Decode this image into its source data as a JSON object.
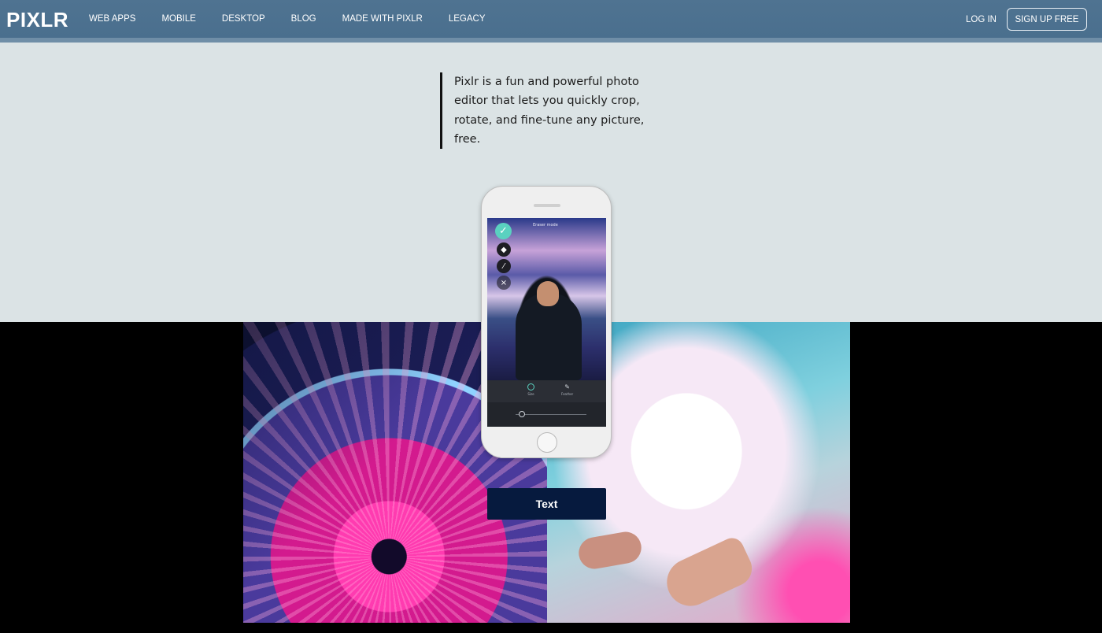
{
  "brand": {
    "logo": "PIXLR"
  },
  "nav": {
    "links": [
      "WEB APPS",
      "MOBILE",
      "DESKTOP",
      "BLOG",
      "MADE WITH PIXLR",
      "LEGACY"
    ],
    "login": "LOG IN",
    "signup": "SIGN UP FREE"
  },
  "hero": {
    "quote": "Pixlr is a fun and powerful photo editor that lets you quickly crop, rotate, and fine-tune any picture, free."
  },
  "phone": {
    "screen_title": "Eraser mode",
    "modes": [
      "Size",
      "Feather"
    ]
  },
  "cta": {
    "text_button": "Text"
  },
  "colors": {
    "nav_bg": "#4f7391",
    "hero_bg": "#dbe3e5",
    "button_bg": "#061a3e",
    "accent": "#5ad1c0"
  },
  "icons": [
    "check-icon",
    "eraser-icon",
    "brush-icon",
    "close-icon",
    "radio-icon",
    "feather-icon"
  ]
}
